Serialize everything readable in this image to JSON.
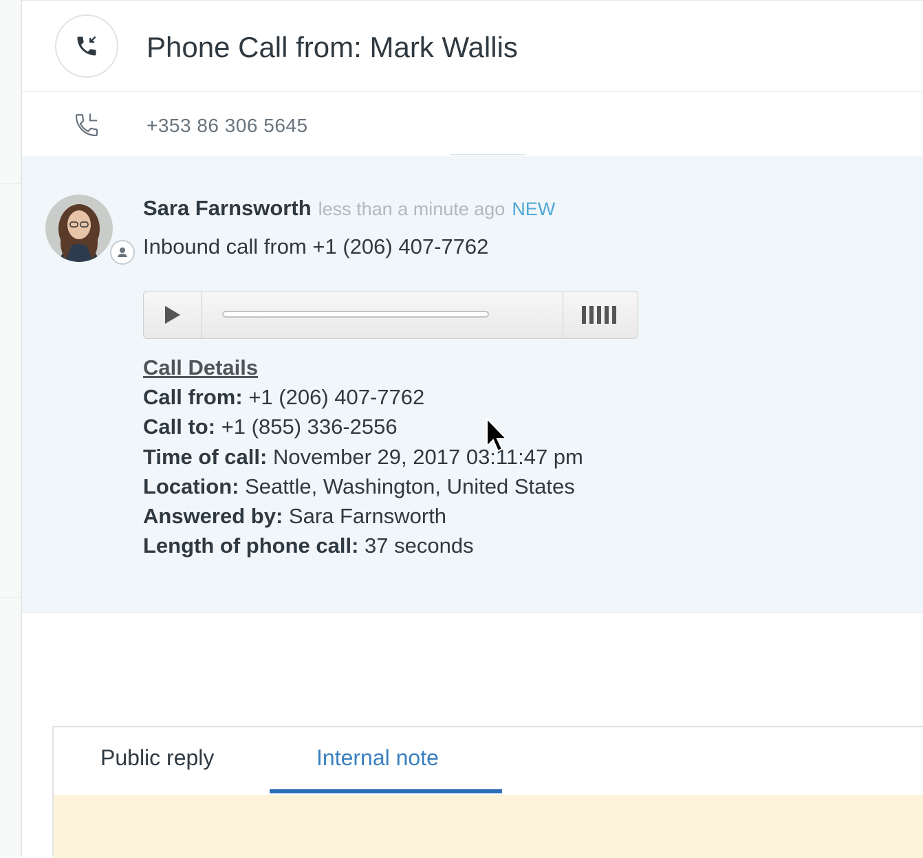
{
  "header": {
    "title": "Phone Call from: Mark Wallis",
    "icon": "phone-incoming-icon"
  },
  "caller": {
    "phone_number": "+353 86 306 5645",
    "icon": "phone-callback-icon"
  },
  "event": {
    "author": "Sara Farnsworth",
    "timestamp": "less than a minute ago",
    "badge": "NEW",
    "summary": "Inbound call from +1 (206) 407-7762",
    "audio": {
      "play_icon": "play-icon",
      "volume_icon": "volume-bars-icon",
      "progress": 0
    },
    "details": {
      "heading": "Call Details",
      "rows": [
        {
          "label": "Call from:",
          "value": "+1 (206) 407-7762"
        },
        {
          "label": "Call to:",
          "value": "+1 (855) 336-2556"
        },
        {
          "label": "Time of call:",
          "value": "November 29, 2017 03:11:47 pm"
        },
        {
          "label": "Location:",
          "value": "Seattle, Washington, United States"
        },
        {
          "label": "Answered by:",
          "value": "Sara Farnsworth"
        },
        {
          "label": "Length of phone call:",
          "value": "37 seconds"
        }
      ]
    }
  },
  "composer": {
    "tabs": [
      {
        "label": "Public reply",
        "active": false
      },
      {
        "label": "Internal note",
        "active": true
      }
    ]
  },
  "colors": {
    "accent": "#2d6fb8",
    "new_badge": "#4fa7d6",
    "event_bg": "#f1f6fa",
    "note_bg": "#fdf4db"
  }
}
